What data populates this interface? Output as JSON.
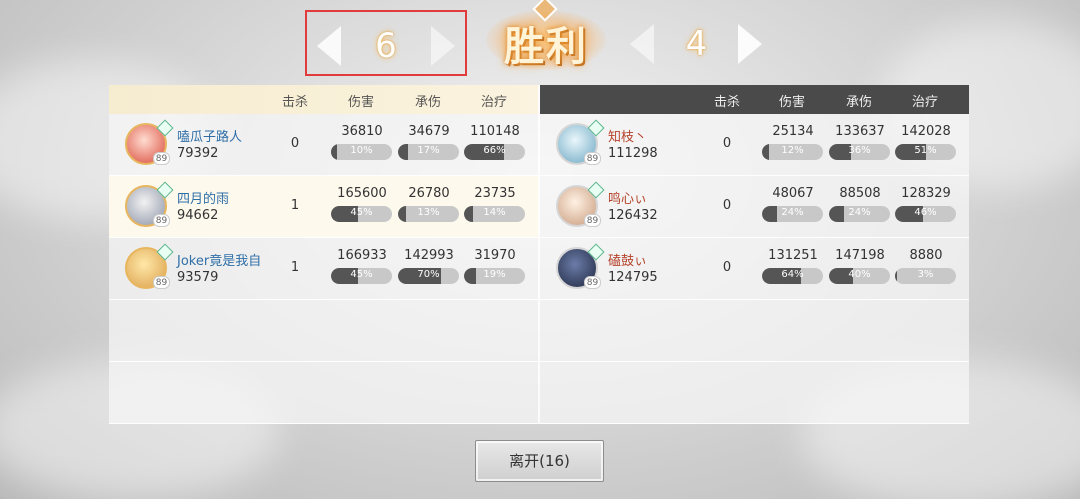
{
  "header": {
    "left_score": "6",
    "right_score": "4",
    "result": "胜利"
  },
  "columns": {
    "kills": "击杀",
    "damage": "伤害",
    "taken": "承伤",
    "healing": "治疗"
  },
  "team_left": [
    {
      "name": "嗑瓜子路人",
      "score": "79392",
      "level": "89",
      "kills": "0",
      "damage": "36810",
      "damage_pct": "10%",
      "damage_frac": 0.1,
      "taken": "34679",
      "taken_pct": "17%",
      "taken_frac": 0.17,
      "healing": "110148",
      "healing_pct": "66%",
      "healing_frac": 0.66
    },
    {
      "name": "四月的雨",
      "score": "94662",
      "level": "89",
      "kills": "1",
      "damage": "165600",
      "damage_pct": "45%",
      "damage_frac": 0.45,
      "taken": "26780",
      "taken_pct": "13%",
      "taken_frac": 0.13,
      "healing": "23735",
      "healing_pct": "14%",
      "healing_frac": 0.14
    },
    {
      "name": "Joker竟是我自",
      "score": "93579",
      "level": "89",
      "kills": "1",
      "damage": "166933",
      "damage_pct": "45%",
      "damage_frac": 0.45,
      "taken": "142993",
      "taken_pct": "70%",
      "taken_frac": 0.7,
      "healing": "31970",
      "healing_pct": "19%",
      "healing_frac": 0.19
    }
  ],
  "team_right": [
    {
      "name": "知枝丶",
      "score": "111298",
      "level": "89",
      "kills": "0",
      "damage": "25134",
      "damage_pct": "12%",
      "damage_frac": 0.12,
      "taken": "133637",
      "taken_pct": "36%",
      "taken_frac": 0.36,
      "healing": "142028",
      "healing_pct": "51%",
      "healing_frac": 0.51
    },
    {
      "name": "鸣心ぃ",
      "score": "126432",
      "level": "89",
      "kills": "0",
      "damage": "48067",
      "damage_pct": "24%",
      "damage_frac": 0.24,
      "taken": "88508",
      "taken_pct": "24%",
      "taken_frac": 0.24,
      "healing": "128329",
      "healing_pct": "46%",
      "healing_frac": 0.46
    },
    {
      "name": "磕鼓ぃ",
      "score": "124795",
      "level": "89",
      "kills": "0",
      "damage": "131251",
      "damage_pct": "64%",
      "damage_frac": 0.64,
      "taken": "147198",
      "taken_pct": "40%",
      "taken_frac": 0.4,
      "healing": "8880",
      "healing_pct": "3%",
      "healing_frac": 0.03
    }
  ],
  "leave_button": "离开(16)"
}
